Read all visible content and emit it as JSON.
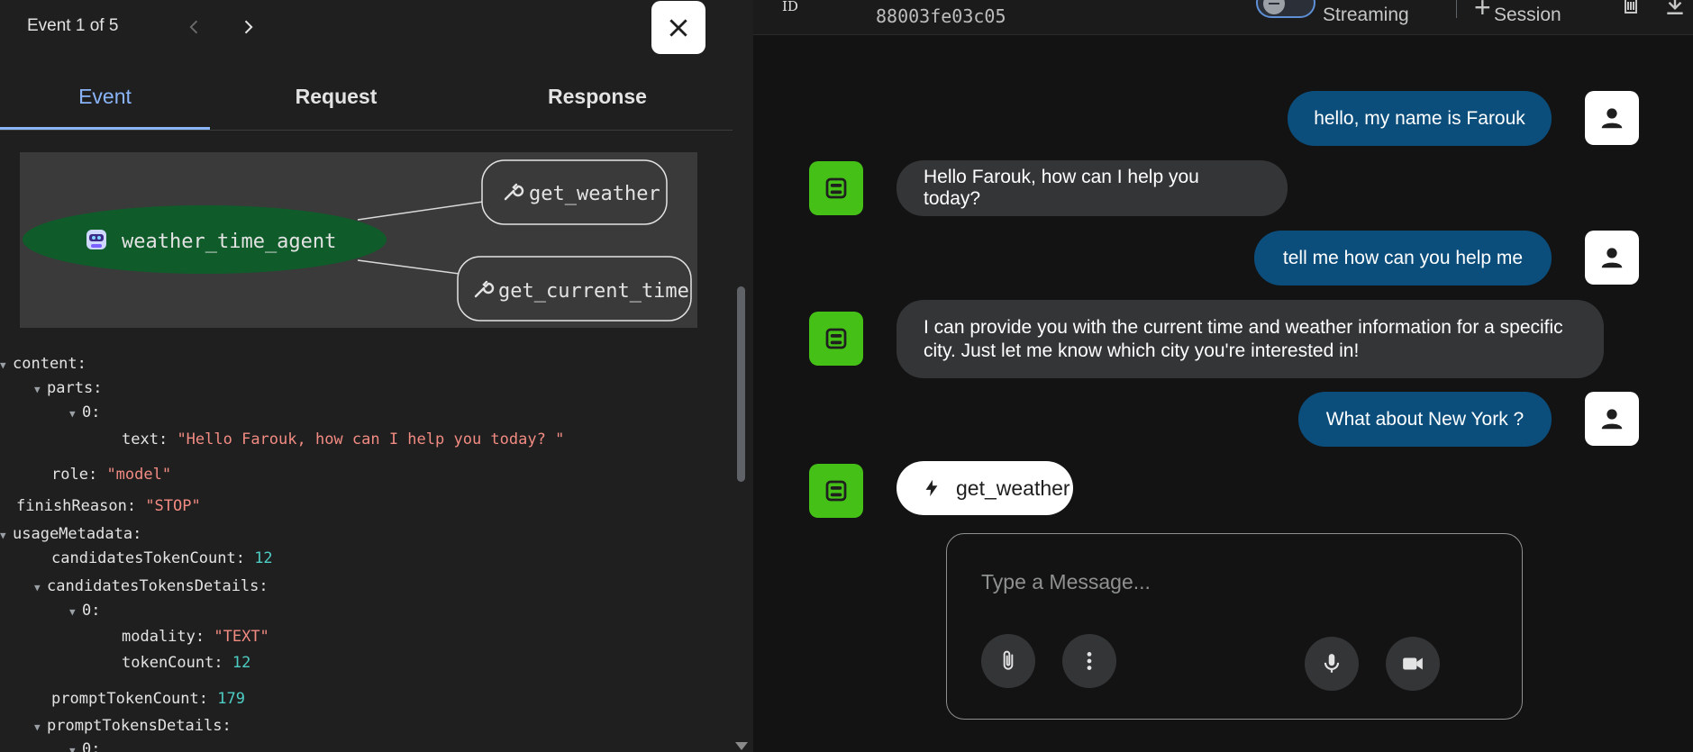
{
  "event_panel": {
    "title": "Event 1 of 5",
    "tabs": [
      {
        "label": "Event",
        "active": true
      },
      {
        "label": "Request",
        "active": false
      },
      {
        "label": "Response",
        "active": false
      }
    ],
    "graph": {
      "agent": "weather_time_agent",
      "tools": [
        "get_weather",
        "get_current_time"
      ],
      "agent_color": "#0f5c2a"
    },
    "json_tree": {
      "content_key": "content",
      "parts_key": "parts",
      "part_index": "0",
      "text_key": "text",
      "text_value": "\"Hello Farouk, how can I help you today? \"",
      "role_key": "role",
      "role_value": "\"model\"",
      "finish_key": "finishReason",
      "finish_value": "\"STOP\"",
      "usage_key": "usageMetadata",
      "cand_count_key": "candidatesTokenCount",
      "cand_count_value": "12",
      "cand_details_key": "candidatesTokensDetails",
      "cand_index": "0",
      "modality_key": "modality",
      "modality_value": "\"TEXT\"",
      "token_count_key": "tokenCount",
      "token_count_value": "12",
      "prompt_count_key": "promptTokenCount",
      "prompt_count_value": "179",
      "prompt_details_key": "promptTokensDetails",
      "prompt_index": "0"
    }
  },
  "topbar": {
    "id_label": "ID",
    "session_id": "88003fe03c05",
    "streaming_label": "Streaming",
    "new_session_label": "Session"
  },
  "chat": {
    "messages": [
      {
        "role": "user",
        "text": "hello, my name is Farouk"
      },
      {
        "role": "bot",
        "text": "Hello Farouk, how can I help you today?"
      },
      {
        "role": "user",
        "text": "tell me how can you help me"
      },
      {
        "role": "bot",
        "text": "I can provide you with the current time and weather information for a specific city. Just let me know which city you're interested in!"
      },
      {
        "role": "user",
        "text": "What about New York ?"
      }
    ],
    "function_call": "get_weather"
  },
  "composer": {
    "placeholder": "Type a Message..."
  },
  "colors": {
    "user_bubble": "#0b4e7c",
    "bot_bubble": "#333537",
    "bot_avatar": "#44c017",
    "active_tab": "#8ab4f8"
  }
}
